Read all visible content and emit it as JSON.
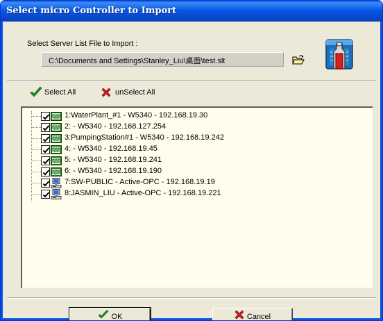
{
  "window": {
    "title": "Select micro Controller to Import"
  },
  "server": {
    "label": "Select Server List File to Import :",
    "path": "C:\\Documents and Settings\\Stanley_Liu\\桌面\\test.slt"
  },
  "toolbar": {
    "select_all": "Select All",
    "unselect_all": "unSelect All"
  },
  "tree": {
    "items": [
      {
        "label": "1:WaterPlant_#1 - W5340 - 192.168.19.30",
        "checked": true,
        "icon": "controller-icon"
      },
      {
        "label": "2: - W5340 - 192.168.127.254",
        "checked": true,
        "icon": "controller-icon"
      },
      {
        "label": "3:PumpingStation#1 - W5340 - 192.168.19.242",
        "checked": true,
        "icon": "controller-icon"
      },
      {
        "label": "4: - W5340 - 192.168.19.45",
        "checked": true,
        "icon": "controller-icon"
      },
      {
        "label": "5: - W5340 - 192.168.19.241",
        "checked": true,
        "icon": "controller-icon"
      },
      {
        "label": "6: - W5340 - 192.168.19.190",
        "checked": true,
        "icon": "controller-icon"
      },
      {
        "label": "7:SW-PUBLIC - Active-OPC - 192.168.19.19",
        "checked": true,
        "icon": "computer-icon"
      },
      {
        "label": "8:JASMIN_LIU - Active-OPC - 192.168.19.221",
        "checked": true,
        "icon": "computer-icon"
      }
    ]
  },
  "buttons": {
    "ok": "OK",
    "cancel": "Cancel"
  },
  "colors": {
    "titlebar": "#0958e6",
    "tree_bg": "#fffeed",
    "dialog_bg": "#ece9d8",
    "check_green": "#1e8c1e",
    "cross_red": "#c81e1e"
  }
}
